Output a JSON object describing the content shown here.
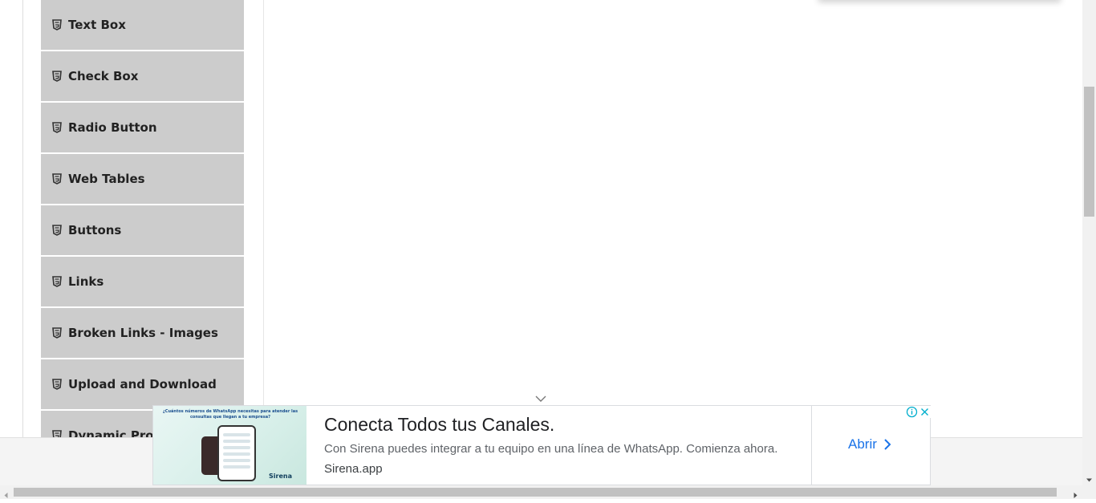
{
  "menu": {
    "items": [
      {
        "label": "Text Box"
      },
      {
        "label": "Check Box"
      },
      {
        "label": "Radio Button"
      },
      {
        "label": "Web Tables"
      },
      {
        "label": "Buttons"
      },
      {
        "label": "Links"
      },
      {
        "label": "Broken Links - Images"
      },
      {
        "label": "Upload and Download"
      },
      {
        "label": "Dynamic Properties"
      }
    ],
    "item_icon": "html5-icon",
    "item_background": "#cccccc"
  },
  "ad": {
    "image_caption": "¿Cuántos números de WhatsApp necesitas para atender las consultas que llegan a tu empresa?",
    "image_brand": "Sirena",
    "title": "Conecta Todos tus Canales.",
    "description": "Con Sirena puedes integrar a tu equipo en una línea de WhatsApp. Comienza ahora.",
    "domain": "Sirena.app",
    "cta_label": "Abrir",
    "accent_color": "#1a73e8",
    "info_icon": "info-icon",
    "close_icon": "close-icon"
  },
  "icons": {
    "scroll_expand": "chevron-down-icon"
  }
}
